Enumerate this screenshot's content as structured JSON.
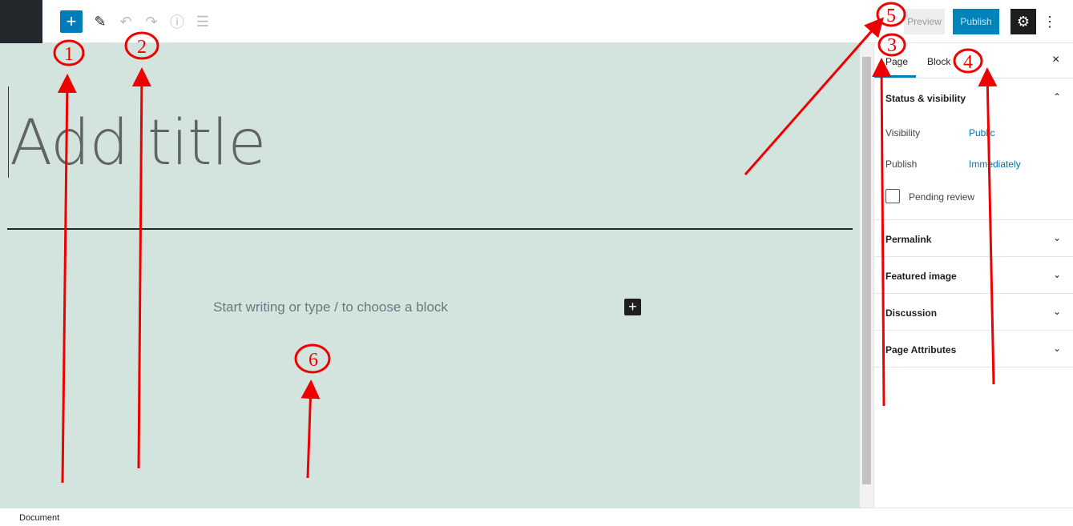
{
  "toolbar": {
    "add_icon": "plus-icon",
    "tools": [
      "pencil-icon",
      "undo-icon",
      "redo-icon",
      "info-icon",
      "list-view-icon"
    ],
    "preview": "Preview",
    "publish": "Publish",
    "settings_icon": "gear-icon",
    "more_icon": "vertical-ellipsis-icon"
  },
  "editor": {
    "title_placeholder": "Add title",
    "body_placeholder": "Start writing or type / to choose a block",
    "background": "#d3e4df"
  },
  "sidebar": {
    "tabs": [
      "Page",
      "Block"
    ],
    "close": "×",
    "status": {
      "heading": "Status & visibility",
      "visibility_label": "Visibility",
      "visibility_value": "Public",
      "publish_label": "Publish",
      "publish_value": "Immediately",
      "pending": "Pending review"
    },
    "sections": [
      "Permalink",
      "Featured image",
      "Discussion",
      "Page Attributes"
    ]
  },
  "footer": {
    "breadcrumb": "Document"
  },
  "annotations": [
    "1",
    "2",
    "3",
    "4",
    "5",
    "6"
  ],
  "colors": {
    "accent": "#007cba",
    "annotation": "#e00000"
  }
}
